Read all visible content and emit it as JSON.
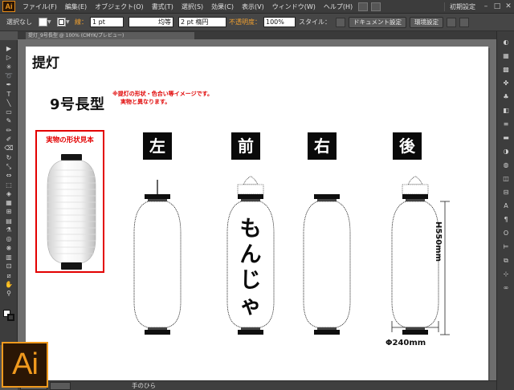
{
  "app": {
    "logo_text": "Ai",
    "colors": {
      "accent": "#f19a1e",
      "logo_bg": "#2b1605",
      "ui_dark": "#3c3c3c",
      "note_red": "#e00000",
      "label_bg": "#0a0a0a"
    }
  },
  "menubar": {
    "items": [
      "ファイル(F)",
      "編集(E)",
      "オブジェクト(O)",
      "書式(T)",
      "選択(S)",
      "効果(C)",
      "表示(V)",
      "ウィンドウ(W)",
      "ヘルプ(H)"
    ],
    "workspace": "初期設定",
    "window_buttons": [
      "–",
      "□",
      "✕"
    ]
  },
  "controlbar": {
    "selection": "選択なし",
    "stroke_label": "線：",
    "stroke_width": "1 pt",
    "stroke_style": "均等",
    "brush": "2 pt 楕円",
    "opacity_label": "不透明度：",
    "opacity_value": "100%",
    "style_label": "スタイル：",
    "doc_settings_button": "ドキュメント設定",
    "prefs_button": "環境設定"
  },
  "document": {
    "tab_label": "提灯_9号長型 @ 100% (CMYK/プレビュー)"
  },
  "artboard": {
    "title": "提灯",
    "model": "9号長型",
    "notes": [
      "※提灯の形状・色合い等イメージです。",
      "実物と異なります。"
    ],
    "sample_label": "実物の形状見本",
    "side_labels": [
      "左",
      "前",
      "右",
      "後"
    ],
    "front_text": [
      "も",
      "ん",
      "じ",
      "ゃ"
    ],
    "height_dimension": "H550mm",
    "width_dimension": "Φ240mm"
  },
  "statusbar": {
    "tool_name": "手のひら"
  },
  "tools": [
    {
      "name": "selection-tool-icon",
      "glyph": "▶"
    },
    {
      "name": "direct-selection-tool-icon",
      "glyph": "▷"
    },
    {
      "name": "magic-wand-tool-icon",
      "glyph": "✳"
    },
    {
      "name": "lasso-tool-icon",
      "glyph": "➰"
    },
    {
      "name": "pen-tool-icon",
      "glyph": "✒"
    },
    {
      "name": "type-tool-icon",
      "glyph": "T"
    },
    {
      "name": "line-tool-icon",
      "glyph": "╲"
    },
    {
      "name": "rectangle-tool-icon",
      "glyph": "▭"
    },
    {
      "name": "paintbrush-tool-icon",
      "glyph": "✎"
    },
    {
      "name": "pencil-tool-icon",
      "glyph": "✏"
    },
    {
      "name": "blob-brush-tool-icon",
      "glyph": "✐"
    },
    {
      "name": "eraser-tool-icon",
      "glyph": "⌫"
    },
    {
      "name": "rotate-tool-icon",
      "glyph": "↻"
    },
    {
      "name": "scale-tool-icon",
      "glyph": "⤡"
    },
    {
      "name": "width-tool-icon",
      "glyph": "⇔"
    },
    {
      "name": "free-transform-tool-icon",
      "glyph": "⬚"
    },
    {
      "name": "shape-builder-tool-icon",
      "glyph": "◈"
    },
    {
      "name": "perspective-grid-tool-icon",
      "glyph": "▦"
    },
    {
      "name": "mesh-tool-icon",
      "glyph": "⊞"
    },
    {
      "name": "gradient-tool-icon",
      "glyph": "▤"
    },
    {
      "name": "eyedropper-tool-icon",
      "glyph": "⚗"
    },
    {
      "name": "blend-tool-icon",
      "glyph": "◎"
    },
    {
      "name": "symbol-sprayer-tool-icon",
      "glyph": "❋"
    },
    {
      "name": "graph-tool-icon",
      "glyph": "▥"
    },
    {
      "name": "artboard-tool-icon",
      "glyph": "⊡"
    },
    {
      "name": "slice-tool-icon",
      "glyph": "⧄"
    },
    {
      "name": "hand-tool-icon",
      "glyph": "✋"
    },
    {
      "name": "zoom-tool-icon",
      "glyph": "⚲"
    }
  ],
  "panels": [
    {
      "name": "color-panel-icon",
      "glyph": "◐"
    },
    {
      "name": "color-guide-panel-icon",
      "glyph": "▦"
    },
    {
      "name": "swatches-panel-icon",
      "glyph": "▩"
    },
    {
      "name": "brushes-panel-icon",
      "glyph": "✤"
    },
    {
      "name": "symbols-panel-icon",
      "glyph": "♣"
    },
    {
      "name": "graphic-styles-panel-icon",
      "glyph": "◧"
    },
    {
      "name": "stroke-panel-icon",
      "glyph": "≡"
    },
    {
      "name": "gradient-panel-icon",
      "glyph": "▬"
    },
    {
      "name": "transparency-panel-icon",
      "glyph": "◑"
    },
    {
      "name": "appearance-panel-icon",
      "glyph": "◍"
    },
    {
      "name": "layers-panel-icon",
      "glyph": "◫"
    },
    {
      "name": "artboards-panel-icon",
      "glyph": "⊟"
    },
    {
      "name": "character-panel-icon",
      "glyph": "A"
    },
    {
      "name": "paragraph-panel-icon",
      "glyph": "¶"
    },
    {
      "name": "opentype-panel-icon",
      "glyph": "O"
    },
    {
      "name": "align-panel-icon",
      "glyph": "⊨"
    },
    {
      "name": "pathfinder-panel-icon",
      "glyph": "⧉"
    },
    {
      "name": "transform-panel-icon",
      "glyph": "⊹"
    },
    {
      "name": "links-panel-icon",
      "glyph": "∞"
    }
  ]
}
